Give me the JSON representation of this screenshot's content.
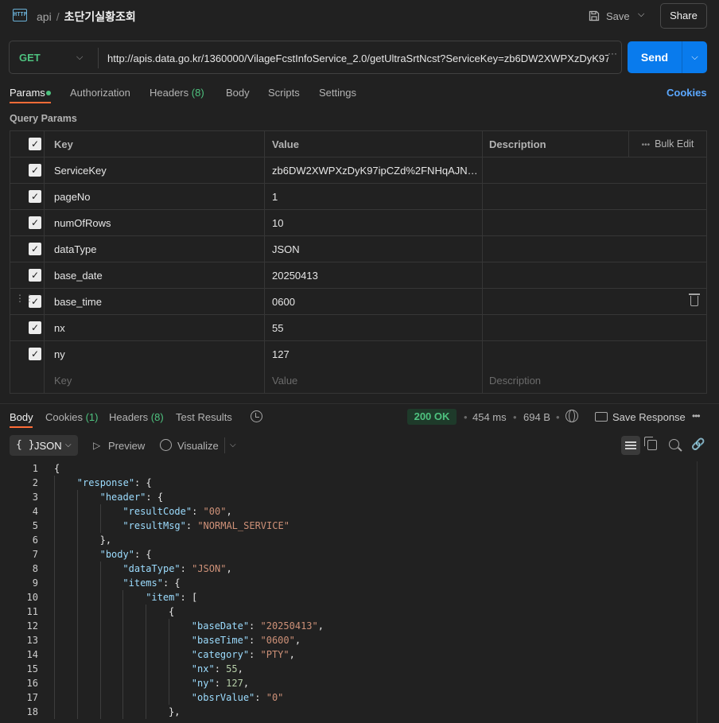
{
  "topbar": {
    "icon_label": "HTTP",
    "collection": "api",
    "separator": "/",
    "request_name": "초단기실황조회",
    "save_label": "Save",
    "share_label": "Share"
  },
  "request": {
    "method": "GET",
    "url": "http://apis.data.go.kr/1360000/VilageFcstInfoService_2.0/getUltraSrtNcst?ServiceKey=zb6DW2XWPXzDyK97i",
    "url_more": "···",
    "send_label": "Send"
  },
  "req_tabs": {
    "params": "Params",
    "authorization": "Authorization",
    "headers": "Headers",
    "headers_count": "(8)",
    "body": "Body",
    "scripts": "Scripts",
    "settings": "Settings",
    "cookies": "Cookies"
  },
  "query_params": {
    "title": "Query Params",
    "columns": {
      "key": "Key",
      "value": "Value",
      "description": "Description",
      "bulk_edit": "Bulk Edit"
    },
    "rows": [
      {
        "key": "ServiceKey",
        "value": "zb6DW2XWPXzDyK97ipCZd%2FNHqAJN68…",
        "description": ""
      },
      {
        "key": "pageNo",
        "value": "1",
        "description": ""
      },
      {
        "key": "numOfRows",
        "value": "10",
        "description": ""
      },
      {
        "key": "dataType",
        "value": "JSON",
        "description": ""
      },
      {
        "key": "base_date",
        "value": "20250413",
        "description": ""
      },
      {
        "key": "base_time",
        "value": "0600",
        "description": ""
      },
      {
        "key": "nx",
        "value": "55",
        "description": ""
      },
      {
        "key": "ny",
        "value": "127",
        "description": ""
      }
    ],
    "placeholders": {
      "key": "Key",
      "value": "Value",
      "description": "Description"
    }
  },
  "response": {
    "tabs": {
      "body": "Body",
      "cookies": "Cookies",
      "cookies_count": "(1)",
      "headers": "Headers",
      "headers_count": "(8)",
      "test_results": "Test Results"
    },
    "status": "200 OK",
    "time": "454 ms",
    "size": "694 B",
    "save_response": "Save Response",
    "format": "JSON",
    "format_braces": "{ }",
    "preview": "Preview",
    "visualize": "Visualize"
  },
  "code_lines": [
    {
      "n": "1",
      "indent": 0,
      "parts": [
        [
          "p",
          "{"
        ]
      ]
    },
    {
      "n": "2",
      "indent": 1,
      "parts": [
        [
          "k",
          "\"response\""
        ],
        [
          "p",
          ": {"
        ]
      ]
    },
    {
      "n": "3",
      "indent": 2,
      "parts": [
        [
          "k",
          "\"header\""
        ],
        [
          "p",
          ": {"
        ]
      ]
    },
    {
      "n": "4",
      "indent": 3,
      "parts": [
        [
          "k",
          "\"resultCode\""
        ],
        [
          "p",
          ": "
        ],
        [
          "s",
          "\"00\""
        ],
        [
          "p",
          ","
        ]
      ]
    },
    {
      "n": "5",
      "indent": 3,
      "parts": [
        [
          "k",
          "\"resultMsg\""
        ],
        [
          "p",
          ": "
        ],
        [
          "s",
          "\"NORMAL_SERVICE\""
        ]
      ]
    },
    {
      "n": "6",
      "indent": 2,
      "parts": [
        [
          "p",
          "},"
        ]
      ]
    },
    {
      "n": "7",
      "indent": 2,
      "parts": [
        [
          "k",
          "\"body\""
        ],
        [
          "p",
          ": {"
        ]
      ]
    },
    {
      "n": "8",
      "indent": 3,
      "parts": [
        [
          "k",
          "\"dataType\""
        ],
        [
          "p",
          ": "
        ],
        [
          "s",
          "\"JSON\""
        ],
        [
          "p",
          ","
        ]
      ]
    },
    {
      "n": "9",
      "indent": 3,
      "parts": [
        [
          "k",
          "\"items\""
        ],
        [
          "p",
          ": {"
        ]
      ]
    },
    {
      "n": "10",
      "indent": 4,
      "parts": [
        [
          "k",
          "\"item\""
        ],
        [
          "p",
          ": ["
        ]
      ]
    },
    {
      "n": "11",
      "indent": 5,
      "parts": [
        [
          "p",
          "{"
        ]
      ]
    },
    {
      "n": "12",
      "indent": 6,
      "parts": [
        [
          "k",
          "\"baseDate\""
        ],
        [
          "p",
          ": "
        ],
        [
          "s",
          "\"20250413\""
        ],
        [
          "p",
          ","
        ]
      ]
    },
    {
      "n": "13",
      "indent": 6,
      "parts": [
        [
          "k",
          "\"baseTime\""
        ],
        [
          "p",
          ": "
        ],
        [
          "s",
          "\"0600\""
        ],
        [
          "p",
          ","
        ]
      ]
    },
    {
      "n": "14",
      "indent": 6,
      "parts": [
        [
          "k",
          "\"category\""
        ],
        [
          "p",
          ": "
        ],
        [
          "s",
          "\"PTY\""
        ],
        [
          "p",
          ","
        ]
      ]
    },
    {
      "n": "15",
      "indent": 6,
      "parts": [
        [
          "k",
          "\"nx\""
        ],
        [
          "p",
          ": "
        ],
        [
          "n",
          "55"
        ],
        [
          "p",
          ","
        ]
      ]
    },
    {
      "n": "16",
      "indent": 6,
      "parts": [
        [
          "k",
          "\"ny\""
        ],
        [
          "p",
          ": "
        ],
        [
          "n",
          "127"
        ],
        [
          "p",
          ","
        ]
      ]
    },
    {
      "n": "17",
      "indent": 6,
      "parts": [
        [
          "k",
          "\"obsrValue\""
        ],
        [
          "p",
          ": "
        ],
        [
          "s",
          "\"0\""
        ]
      ]
    },
    {
      "n": "18",
      "indent": 5,
      "parts": [
        [
          "p",
          "},"
        ]
      ]
    }
  ],
  "colors": {
    "accent_tab": "#ff6c37",
    "send": "#097bed",
    "method_get": "#4ec27f",
    "status_ok": "#4ec27f",
    "json_key": "#9cdcfe",
    "json_string": "#ce9178",
    "json_number": "#b5cea8"
  }
}
